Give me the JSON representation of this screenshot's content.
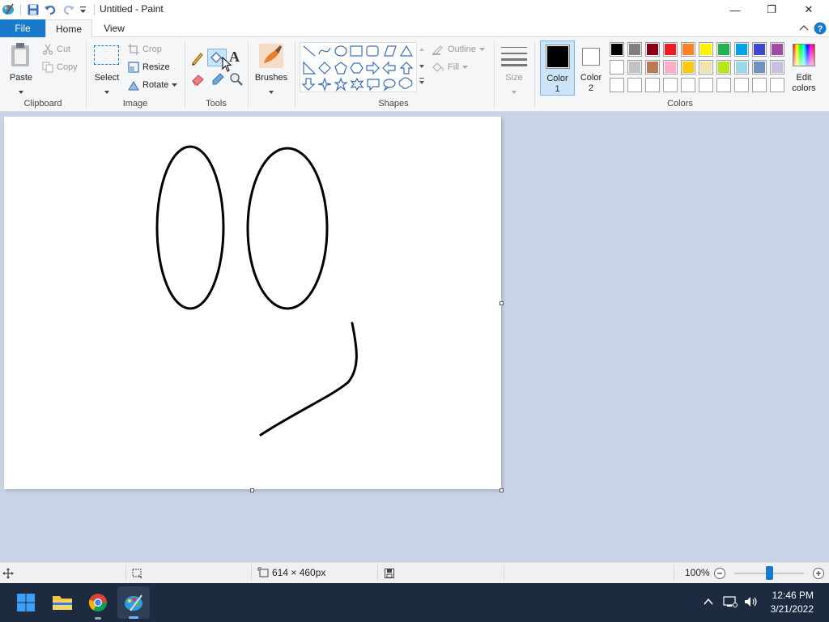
{
  "window": {
    "title": "Untitled - Paint",
    "minimize_glyph": "—",
    "restore_glyph": "❐",
    "close_glyph": "✕"
  },
  "tabs": [
    {
      "label": "File"
    },
    {
      "label": "Home"
    },
    {
      "label": "View"
    }
  ],
  "ribbon": {
    "clipboard": {
      "label": "Clipboard",
      "paste": "Paste",
      "cut": "Cut",
      "copy": "Copy"
    },
    "image": {
      "label": "Image",
      "select": "Select",
      "crop": "Crop",
      "resize": "Resize",
      "rotate": "Rotate"
    },
    "tools": {
      "label": "Tools",
      "text_glyph": "A"
    },
    "brushes": {
      "label": "Brushes"
    },
    "shapes": {
      "label": "Shapes",
      "outline": "Outline",
      "fill": "Fill"
    },
    "size": {
      "label": "Size"
    },
    "color1": {
      "label_line1": "Color",
      "label_line2": "1",
      "value": "#000000"
    },
    "color2": {
      "label_line1": "Color",
      "label_line2": "2",
      "value": "#ffffff"
    },
    "colors": {
      "label": "Colors",
      "row1": [
        "#000000",
        "#7f7f7f",
        "#880015",
        "#ed1c24",
        "#ff7f27",
        "#fff200",
        "#22b14c",
        "#00a2e8",
        "#3f48cc",
        "#a349a4"
      ],
      "row2": [
        "#ffffff",
        "#c3c3c3",
        "#b97a57",
        "#ffaec9",
        "#ffc90e",
        "#efe4b0",
        "#b5e61d",
        "#99d9ea",
        "#7092be",
        "#c8bfe7"
      ],
      "row3": [
        "#ffffff",
        "#ffffff",
        "#ffffff",
        "#ffffff",
        "#ffffff",
        "#ffffff",
        "#ffffff",
        "#ffffff",
        "#ffffff",
        "#ffffff"
      ]
    },
    "edit_colors": {
      "label_line1": "Edit",
      "label_line2": "colors"
    }
  },
  "status": {
    "canvas_size": "614 × 460px",
    "zoom": "100%",
    "zoom_fraction": 0.5
  },
  "taskbar": {
    "time": "12:46 PM",
    "date": "3/21/2022"
  }
}
